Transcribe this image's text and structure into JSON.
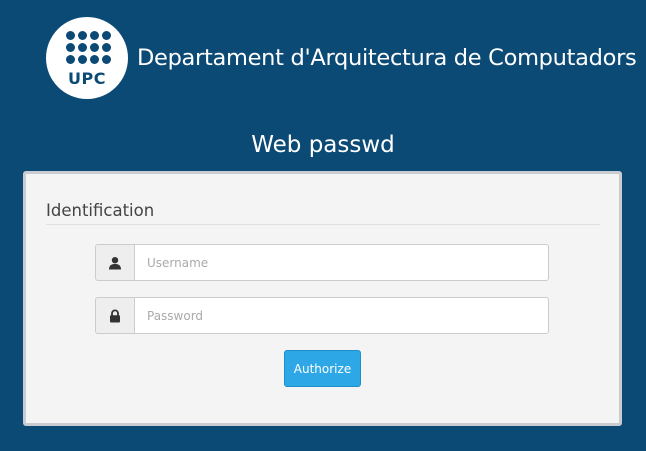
{
  "header": {
    "logo_text": "UPC",
    "department": "Departament d'Arquitectura de Computadors"
  },
  "app": {
    "title": "Web passwd"
  },
  "form": {
    "legend": "Identification",
    "username": {
      "icon": "user-icon",
      "placeholder": "Username",
      "value": ""
    },
    "password": {
      "icon": "lock-icon",
      "placeholder": "Password",
      "value": ""
    },
    "submit_label": "Authorize"
  },
  "colors": {
    "background": "#0c4a76",
    "panel": "#f4f4f4",
    "button": "#2ea7e6"
  }
}
